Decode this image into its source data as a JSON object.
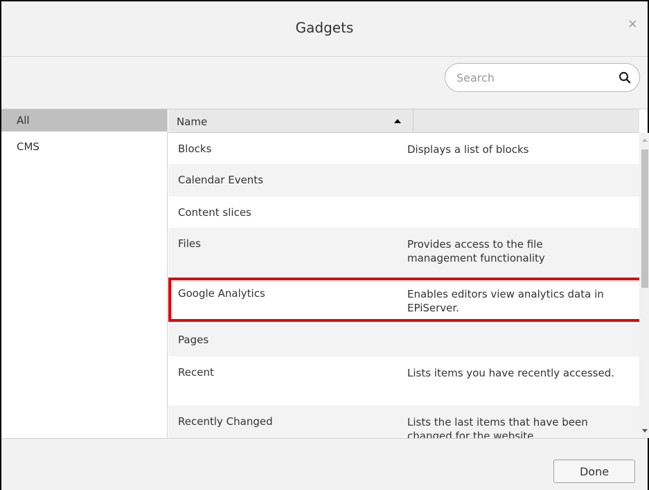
{
  "dialog": {
    "title": "Gadgets",
    "close_glyph": "×"
  },
  "search": {
    "placeholder": "Search",
    "value": ""
  },
  "categories": [
    {
      "label": "All",
      "selected": true
    },
    {
      "label": "CMS",
      "selected": false
    }
  ],
  "grid": {
    "columns": [
      "Name",
      ""
    ],
    "sort": {
      "column": "Name",
      "direction": "ascending"
    },
    "rows": [
      {
        "name": "Blocks",
        "description": "Displays a list of blocks"
      },
      {
        "name": "Calendar Events",
        "description": ""
      },
      {
        "name": "Content slices",
        "description": ""
      },
      {
        "name": "Files",
        "description": "Provides access to the file management functionality"
      },
      {
        "name": "Google Analytics",
        "description": "Enables editors view analytics data in EPiServer.",
        "highlighted": true
      },
      {
        "name": "Pages",
        "description": ""
      },
      {
        "name": "Recent",
        "description": "Lists items you have recently accessed."
      },
      {
        "name": "Recently Changed",
        "description": "Lists the last items that have been changed for the website"
      }
    ]
  },
  "footer": {
    "done_label": "Done"
  },
  "colors": {
    "highlight": "#e00000",
    "selected_category": "#bfbfbf",
    "header_bg": "#f2f2f2"
  }
}
